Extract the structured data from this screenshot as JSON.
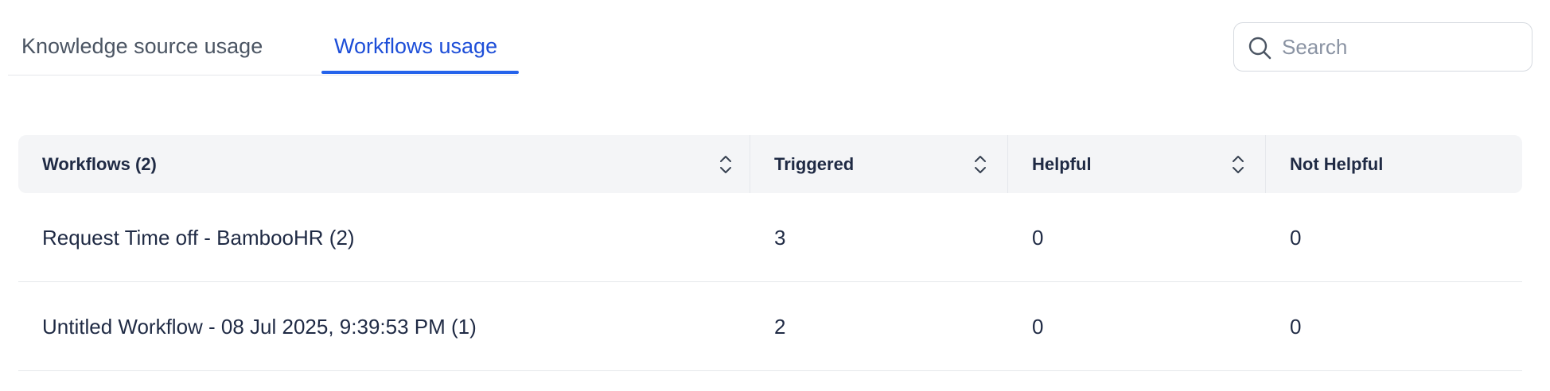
{
  "tabs": [
    {
      "label": "Knowledge source usage",
      "active": false
    },
    {
      "label": "Workflows usage",
      "active": true
    }
  ],
  "search": {
    "placeholder": "Search",
    "value": "",
    "icon": "search-icon"
  },
  "table": {
    "columns": [
      {
        "label": "Workflows (2)",
        "sortable": true
      },
      {
        "label": "Triggered",
        "sortable": true
      },
      {
        "label": "Helpful",
        "sortable": true
      },
      {
        "label": "Not Helpful",
        "sortable": false
      }
    ],
    "rows": [
      {
        "workflow": "Request Time off - BambooHR (2)",
        "triggered": "3",
        "helpful": "0",
        "not_helpful": "0"
      },
      {
        "workflow": "Untitled Workflow - 08 Jul 2025, 9:39:53 PM (1)",
        "triggered": "2",
        "helpful": "0",
        "not_helpful": "0"
      }
    ]
  },
  "colors": {
    "active_tab": "#1d4ed8",
    "underline": "#2563eb",
    "header_bg": "#f4f5f7",
    "text": "#1f2a44"
  }
}
